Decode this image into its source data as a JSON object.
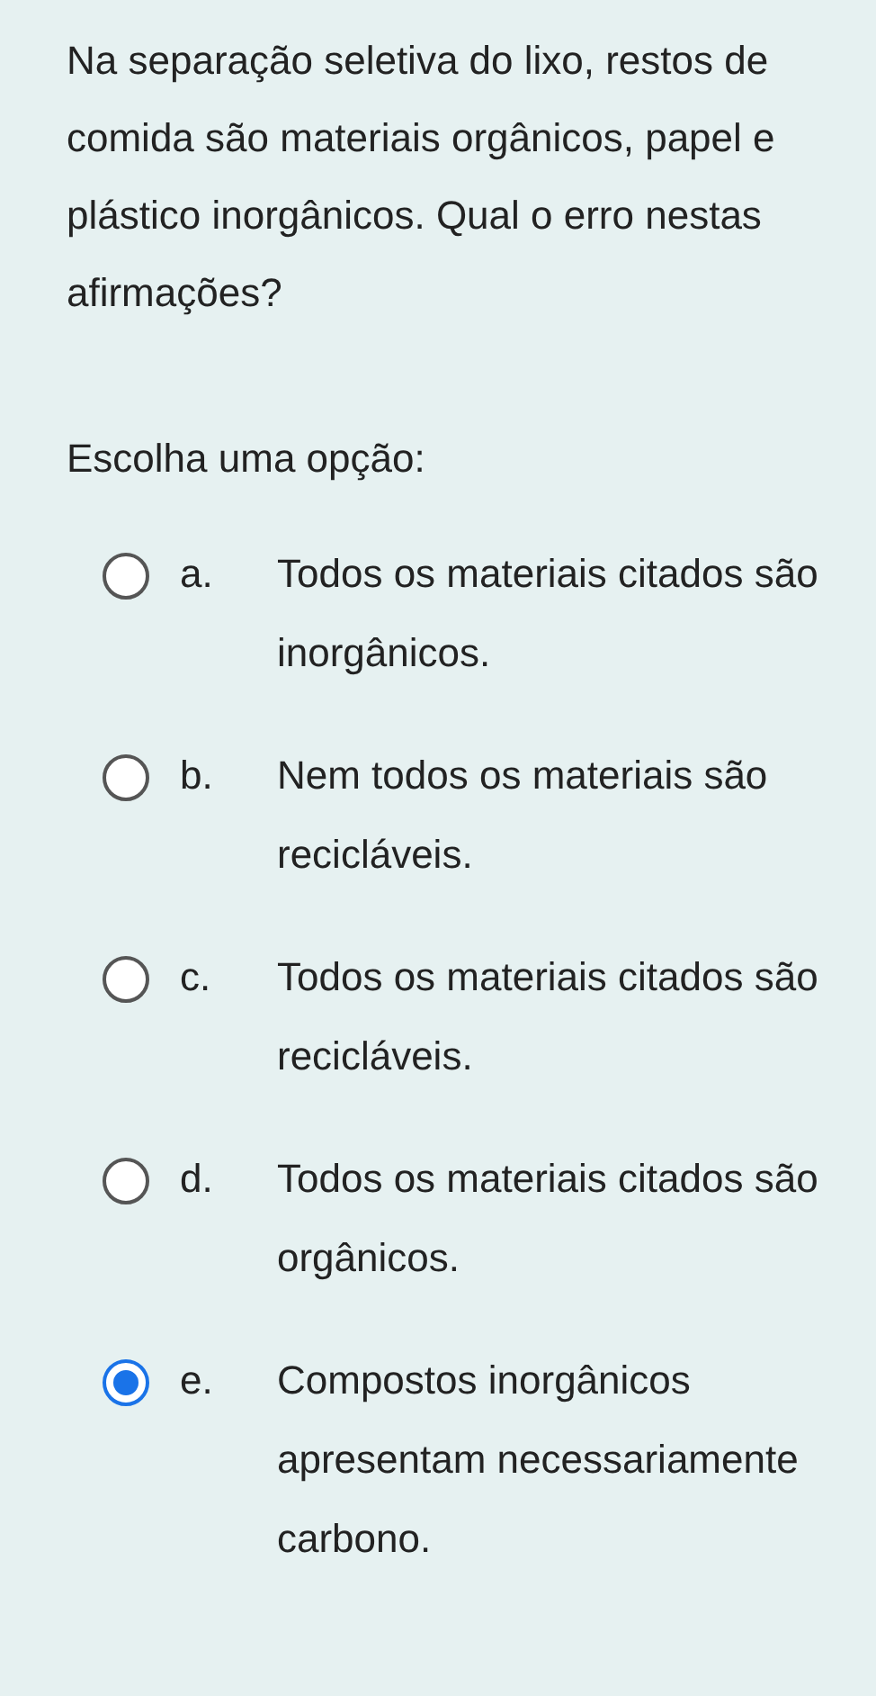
{
  "question": "Na separação seletiva do lixo, restos de comida são materiais orgânicos, papel e plástico inorgânicos. Qual o erro nestas afirmações?",
  "prompt": "Escolha uma opção:",
  "options": [
    {
      "letter": "a.",
      "text": "Todos os materiais citados são inorgânicos.",
      "selected": false
    },
    {
      "letter": "b.",
      "text": "Nem todos os materiais são recicláveis.",
      "selected": false
    },
    {
      "letter": "c.",
      "text": "Todos os materiais citados são recicláveis.",
      "selected": false
    },
    {
      "letter": "d.",
      "text": "Todos os materiais citados são orgânicos.",
      "selected": false
    },
    {
      "letter": "e.",
      "text": "Compostos inorgânicos apresentam necessariamente carbono.",
      "selected": true
    }
  ]
}
